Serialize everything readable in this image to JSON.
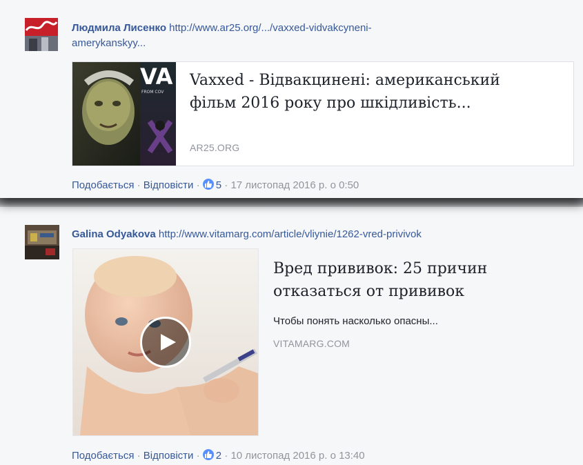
{
  "comments": [
    {
      "author": "Людмила Лисенко",
      "url_line1": "http://www.ar25.org/.../vaxxed-vidvakcyneni-",
      "url_line2": "amerykanskyy...",
      "preview": {
        "title_line1": "Vaxxed - Відвакцинені: американський",
        "title_line2": "фільм 2016 року про шкідливість...",
        "domain": "AR25.ORG",
        "thumb_text": "VA",
        "thumb_small_text": "FROM COV"
      },
      "actions": {
        "like": "Подобається",
        "reply": "Відповісти",
        "sep": "·",
        "reactions": "5",
        "time": "17 листопад 2016 р. о 0:50"
      }
    },
    {
      "author": "Galina Odyakova",
      "url": "http://www.vitamarg.com/article/vliynie/1262-vred-privivok",
      "preview": {
        "title_line1": "Вред прививок: 25 причин",
        "title_line2": "отказаться от прививок",
        "description": "Чтобы понять насколько опасны...",
        "domain": "VITAMARG.COM"
      },
      "actions": {
        "like": "Подобається",
        "reply": "Відповісти",
        "sep": "·",
        "reactions": "2",
        "time": "10 листопад 2016 р. о 13:40"
      }
    }
  ],
  "colors": {
    "link": "#365899",
    "meta": "#90949c",
    "like_icon": "#5890ff",
    "background": "#f6f7f9"
  },
  "icons": {
    "reaction": "thumbs-up-icon",
    "video": "play-icon"
  }
}
